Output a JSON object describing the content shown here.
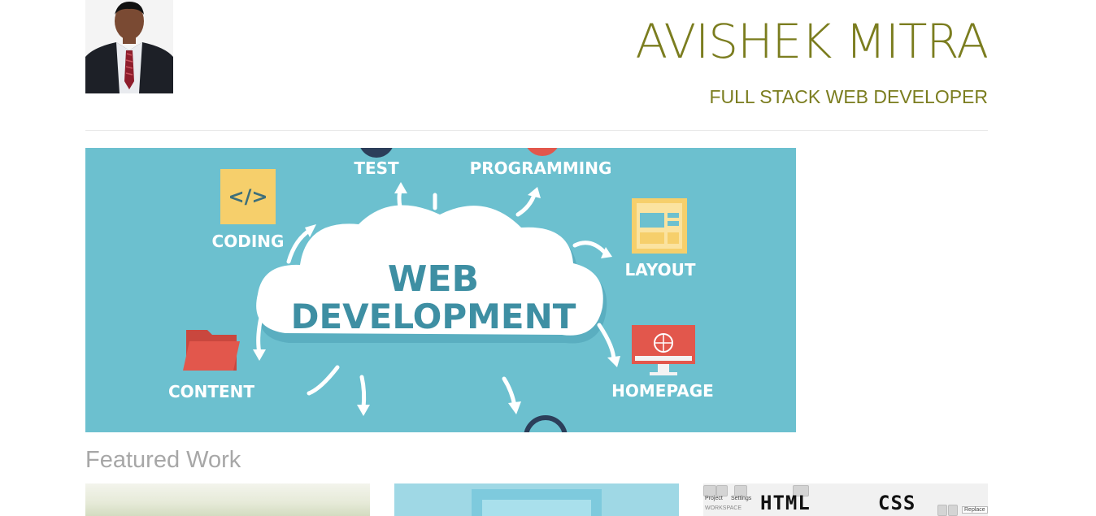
{
  "header": {
    "name": "AVISHEK MITRA",
    "role": "FULL STACK WEB DEVELOPER"
  },
  "banner": {
    "title_line1": "WEB",
    "title_line2": "DEVELOPMENT",
    "labels": {
      "test": "TEST",
      "programming": "PROGRAMMING",
      "coding": "CODING",
      "layout": "LAYOUT",
      "content": "CONTENT",
      "homepage": "HOMEPAGE"
    },
    "code_glyph": "</>",
    "colors": {
      "background": "#6cc0cf",
      "cloud": "#ffffff",
      "title": "#3e8fa3",
      "label": "#ffffff",
      "yellow": "#f6cf6b",
      "red": "#e2574c"
    }
  },
  "featured": {
    "title": "Featured Work",
    "thumb3": {
      "project_label": "Project",
      "settings_label": "Settings",
      "workspace_label": "WORKSPACE",
      "replace_label": "Replace",
      "html_word": "HTML",
      "css_word": "CSS"
    }
  },
  "colors": {
    "accent": "#7b7d1f",
    "muted_heading": "#a7a7a7",
    "divider": "#e8e8e8"
  }
}
